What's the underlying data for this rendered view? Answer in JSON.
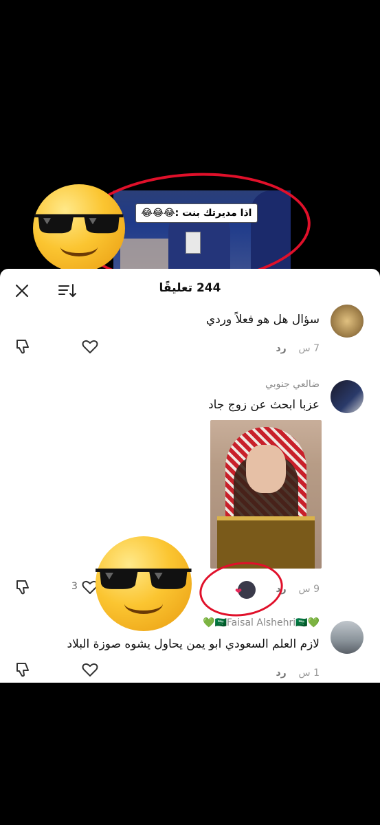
{
  "video": {
    "caption": "اذا مديرتك بنت :😂😂😂"
  },
  "header": {
    "title": "244 تعليقًا",
    "close_icon": "close-icon",
    "sort_icon": "sort-icon"
  },
  "comments": [
    {
      "text": "سؤال هل هو فعلاً وردي",
      "time": "7 س",
      "reply_label": "رد"
    },
    {
      "username": "ضالعي جنوبي",
      "text": "عزبا ابحث عن زوج جاد",
      "time": "9 س",
      "reply_label": "رد",
      "likes": "3"
    },
    {
      "username": "💚🇸🇦Faisal Alshehri🇸🇦💚",
      "text": "لازم العلم السعودي ابو يمن يحاول يشوه صوزة البلاد",
      "time": "1 س",
      "reply_label": "رد"
    }
  ],
  "colors": {
    "accent_red": "#e0102a",
    "like_heart": "#e62a5a"
  }
}
